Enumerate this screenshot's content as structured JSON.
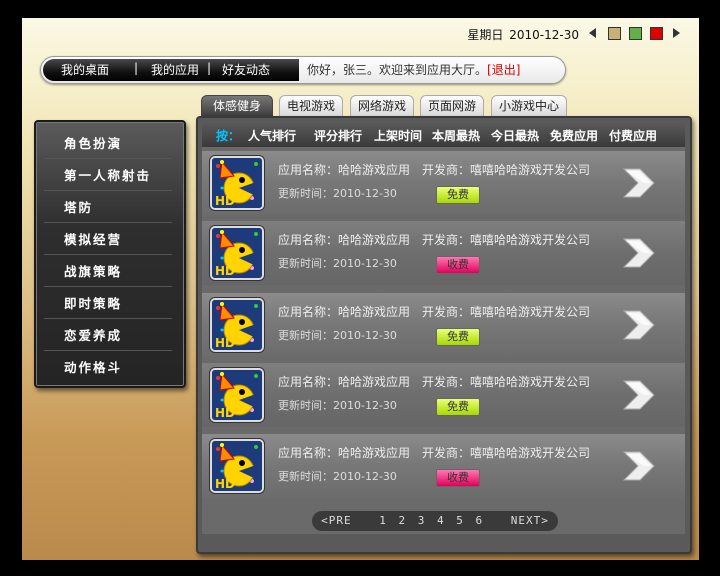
{
  "header": {
    "weekday": "星期日",
    "date": "2010-12-30",
    "swatches": [
      "#c8b079",
      "#63b04a",
      "#e00000"
    ]
  },
  "nav": {
    "links": [
      "我的桌面",
      "我的应用",
      "好友动态"
    ],
    "welcome": "你好，张三。欢迎来到应用大厅。",
    "logout": "[退出]"
  },
  "tabs": [
    {
      "label": "体感健身",
      "active": true
    },
    {
      "label": "电视游戏",
      "active": false
    },
    {
      "label": "网络游戏",
      "active": false
    },
    {
      "label": "页面网游",
      "active": false
    },
    {
      "label": "小游戏中心",
      "active": false
    }
  ],
  "sidebar": {
    "items": [
      "角色扮演",
      "第一人称射击",
      "塔防",
      "模拟经营",
      "战旗策略",
      "即时策略",
      "恋爱养成",
      "动作格斗"
    ]
  },
  "sortbar": {
    "label": "按：",
    "items": [
      "人气排行",
      "评分排行",
      "上架时间",
      "本周最热",
      "今日最热",
      "免费应用",
      "付费应用"
    ]
  },
  "apps": [
    {
      "name": "应用名称：哈哈游戏应用",
      "dev": "开发商：嘻嘻哈哈游戏开发公司",
      "time": "更新时间：2010-12-30",
      "price": "免费",
      "paid": false
    },
    {
      "name": "应用名称：哈哈游戏应用",
      "dev": "开发商：嘻嘻哈哈游戏开发公司",
      "time": "更新时间：2010-12-30",
      "price": "收费",
      "paid": true
    },
    {
      "name": "应用名称：哈哈游戏应用",
      "dev": "开发商：嘻嘻哈哈游戏开发公司",
      "time": "更新时间：2010-12-30",
      "price": "免费",
      "paid": false
    },
    {
      "name": "应用名称：哈哈游戏应用",
      "dev": "开发商：嘻嘻哈哈游戏开发公司",
      "time": "更新时间：2010-12-30",
      "price": "免费",
      "paid": false
    },
    {
      "name": "应用名称：哈哈游戏应用",
      "dev": "开发商：嘻嘻哈哈游戏开发公司",
      "time": "更新时间：2010-12-30",
      "price": "收费",
      "paid": true
    }
  ],
  "pager": {
    "prev": "<PRE",
    "pages": [
      "1",
      "2",
      "3",
      "4",
      "5",
      "6"
    ],
    "next": "NEXT>"
  }
}
